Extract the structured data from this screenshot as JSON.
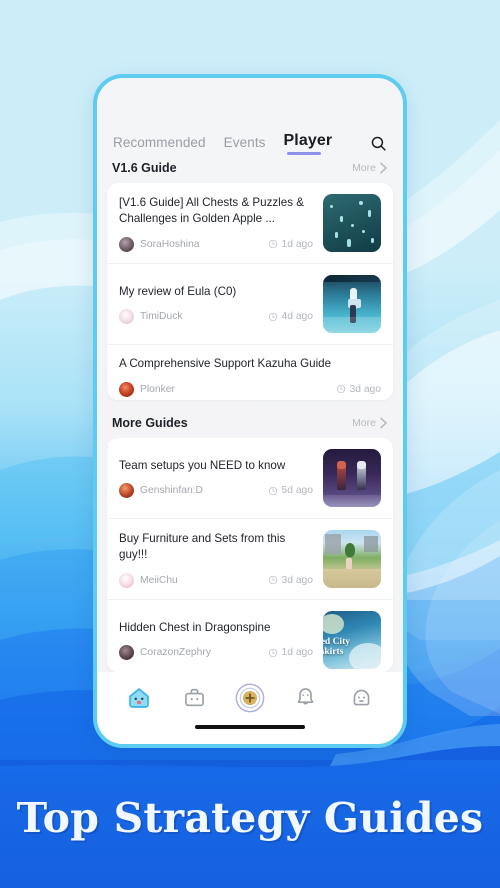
{
  "background": {
    "top_color": "#cdeef9",
    "bottom_color": "#1560e0",
    "wave_color": "#ffffff"
  },
  "phone": {
    "frame_color": "#5ccdf0",
    "screen_bg": "#f4f5f7"
  },
  "tabs": [
    {
      "label": "Recommended",
      "active": false
    },
    {
      "label": "Events",
      "active": false
    },
    {
      "label": "Player",
      "active": true
    }
  ],
  "search": {
    "icon": "search-icon"
  },
  "sections": [
    {
      "title": "V1.6 Guide",
      "more_label": "More",
      "more_icon": "chevron-right-icon",
      "items": [
        {
          "title": "[V1.6 Guide] All Chests & Puzzles & Challenges in Golden Apple ...",
          "author": "SoraHoshina",
          "time": "1d ago",
          "time_icon": "clock-icon",
          "has_thumb": true,
          "thumb_kind": "night-sea-lumenspar",
          "avatar_color": "#6b5a63"
        },
        {
          "title": "My review of Eula (C0)",
          "author": "TimiDuck",
          "time": "4d ago",
          "time_icon": "clock-icon",
          "has_thumb": true,
          "thumb_kind": "eula-character-shot",
          "avatar_color": "#e8d7e0"
        },
        {
          "title": "A Comprehensive Support Kazuha Guide",
          "author": "Plonker",
          "time": "3d ago",
          "time_icon": "clock-icon",
          "has_thumb": false,
          "thumb_kind": "",
          "avatar_color": "#a02e1f"
        }
      ]
    },
    {
      "title": "More Guides",
      "more_label": "More",
      "more_icon": "chevron-right-icon",
      "items": [
        {
          "title": "Team setups you NEED to know",
          "author": "Genshinfan:D",
          "time": "5d ago",
          "time_icon": "clock-icon",
          "has_thumb": true,
          "thumb_kind": "two-characters-purple",
          "avatar_color": "#9c3420"
        },
        {
          "title": "Buy Furniture and Sets from this guy!!!",
          "author": "MeiiChu",
          "time": "3d ago",
          "time_icon": "clock-icon",
          "has_thumb": true,
          "thumb_kind": "serenitea-pot-field",
          "avatar_color": "#e9c3cf"
        },
        {
          "title": "Hidden Chest in Dragonspine",
          "author": "CorazonZephry",
          "time": "1d ago",
          "time_icon": "clock-icon",
          "has_thumb": true,
          "thumb_kind": "map-sealed-city-outskirts",
          "thumb_caption_1": "ed City",
          "thumb_caption_2": "skirts",
          "avatar_color": "#4d3a41"
        }
      ]
    }
  ],
  "bottom_nav": [
    {
      "name": "home-slime-icon",
      "label": "Home",
      "active": true
    },
    {
      "name": "toolbox-icon",
      "label": "Tools",
      "active": false
    },
    {
      "name": "add-post-icon",
      "label": "Post",
      "active": false
    },
    {
      "name": "bell-icon",
      "label": "Notifications",
      "active": false
    },
    {
      "name": "profile-ghost-icon",
      "label": "Me",
      "active": false
    }
  ],
  "home_indicator": {
    "visible": true
  },
  "banner": {
    "text": "Top Strategy Guides"
  }
}
